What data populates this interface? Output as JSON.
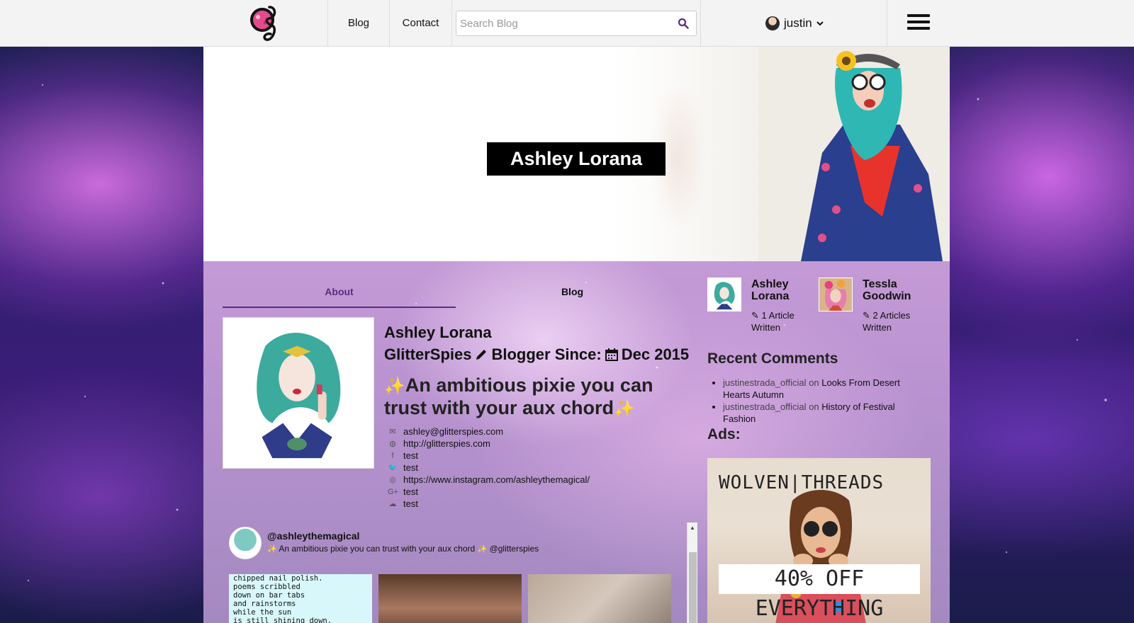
{
  "nav": {
    "links": [
      "Blog",
      "Contact"
    ],
    "search_placeholder": "Search Blog",
    "username": "justin"
  },
  "banner": {
    "name": "Ashley Lorana"
  },
  "profile": {
    "tabs": [
      "About",
      "Blog"
    ],
    "active_tab": "About",
    "name": "Ashley Lorana",
    "since_prefix": "GlitterSpies",
    "since_label": "Blogger Since:",
    "since_date": "Dec 2015",
    "bio": "An ambitious pixie you can trust with your aux chord",
    "contacts": [
      {
        "icon": "envelope-icon",
        "value": "ashley@glitterspies.com"
      },
      {
        "icon": "globe-icon",
        "value": "http://glitterspies.com"
      },
      {
        "icon": "facebook-icon",
        "value": "test"
      },
      {
        "icon": "twitter-icon",
        "value": "test"
      },
      {
        "icon": "instagram-icon",
        "value": "https://www.instagram.com/ashleythemagical/"
      },
      {
        "icon": "google-plus-icon",
        "value": "test"
      },
      {
        "icon": "soundcloud-icon",
        "value": "test"
      }
    ]
  },
  "instagram": {
    "handle": "@ashleythemagical",
    "bio": "An ambitious pixie you can trust with your aux chord",
    "bio_mention": "@glitterspies",
    "poem_lines": [
      "chipped nail polish.",
      "poems scribbled",
      "down on bar tabs",
      "and rainstorms",
      "while the sun",
      "is still shining down."
    ]
  },
  "sidebar": {
    "authors": [
      {
        "name": "Ashley Lorana",
        "count": "1 Article Written"
      },
      {
        "name": "Tessla Goodwin",
        "count": "2 Articles Written"
      }
    ],
    "recent_comments_title": "Recent Comments",
    "comments": [
      {
        "user": "justinestrada_official",
        "on": "on",
        "post": "Looks From Desert Hearts Autumn"
      },
      {
        "user": "justinestrada_official",
        "on": "on",
        "post": "History of Festival Fashion"
      }
    ],
    "ads_title": "Ads:",
    "ad": {
      "brand": "WOLVEN|THREADS",
      "promo": "40% OFF EVERYTHING"
    }
  },
  "colors": {
    "accent": "#5b2c80",
    "topbar": "#f3f3f3"
  }
}
